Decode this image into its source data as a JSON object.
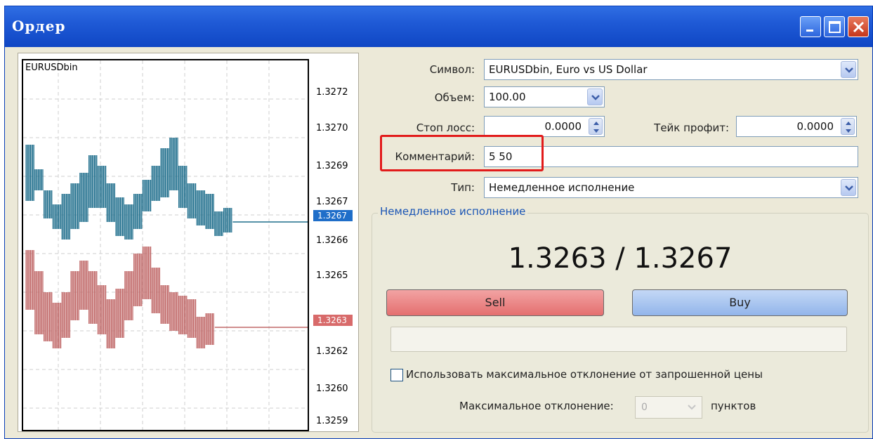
{
  "window": {
    "title": "Ордер"
  },
  "chart": {
    "symbol": "EURUSDbin",
    "price_labels": [
      "1.3272",
      "1.3270",
      "1.3269",
      "1.3267",
      "1.3266",
      "1.3265",
      "1.3263",
      "1.3262",
      "1.3260",
      "1.3259"
    ],
    "ask_tag": "1.3267",
    "bid_tag": "1.3263",
    "ask_color": "#1f6e8c",
    "bid_color": "#c06868"
  },
  "form": {
    "symbol_label": "Символ:",
    "symbol_value": "EURUSDbin, Euro vs US Dollar",
    "volume_label": "Объем:",
    "volume_value": "100.00",
    "stoploss_label": "Стоп лосс:",
    "stoploss_value": "0.0000",
    "takeprofit_label": "Тейк профит:",
    "takeprofit_value": "0.0000",
    "comment_label": "Комментарий:",
    "comment_value": "5 50",
    "type_label": "Тип:",
    "type_value": "Немедленное исполнение"
  },
  "execution": {
    "group_title": "Немедленное исполнение",
    "quote": "1.3263 / 1.3267",
    "sell_label": "Sell",
    "buy_label": "Buy",
    "deviation_checkbox_label": "Использовать максимальное отклонение от запрошенной цены",
    "deviation_checked": false,
    "max_deviation_label": "Максимальное отклонение:",
    "max_deviation_value": "0",
    "deviation_unit": "пунктов"
  },
  "colors": {
    "highlight": "#e21b1b",
    "sell": "#e46f6f",
    "buy": "#92b5ea"
  }
}
